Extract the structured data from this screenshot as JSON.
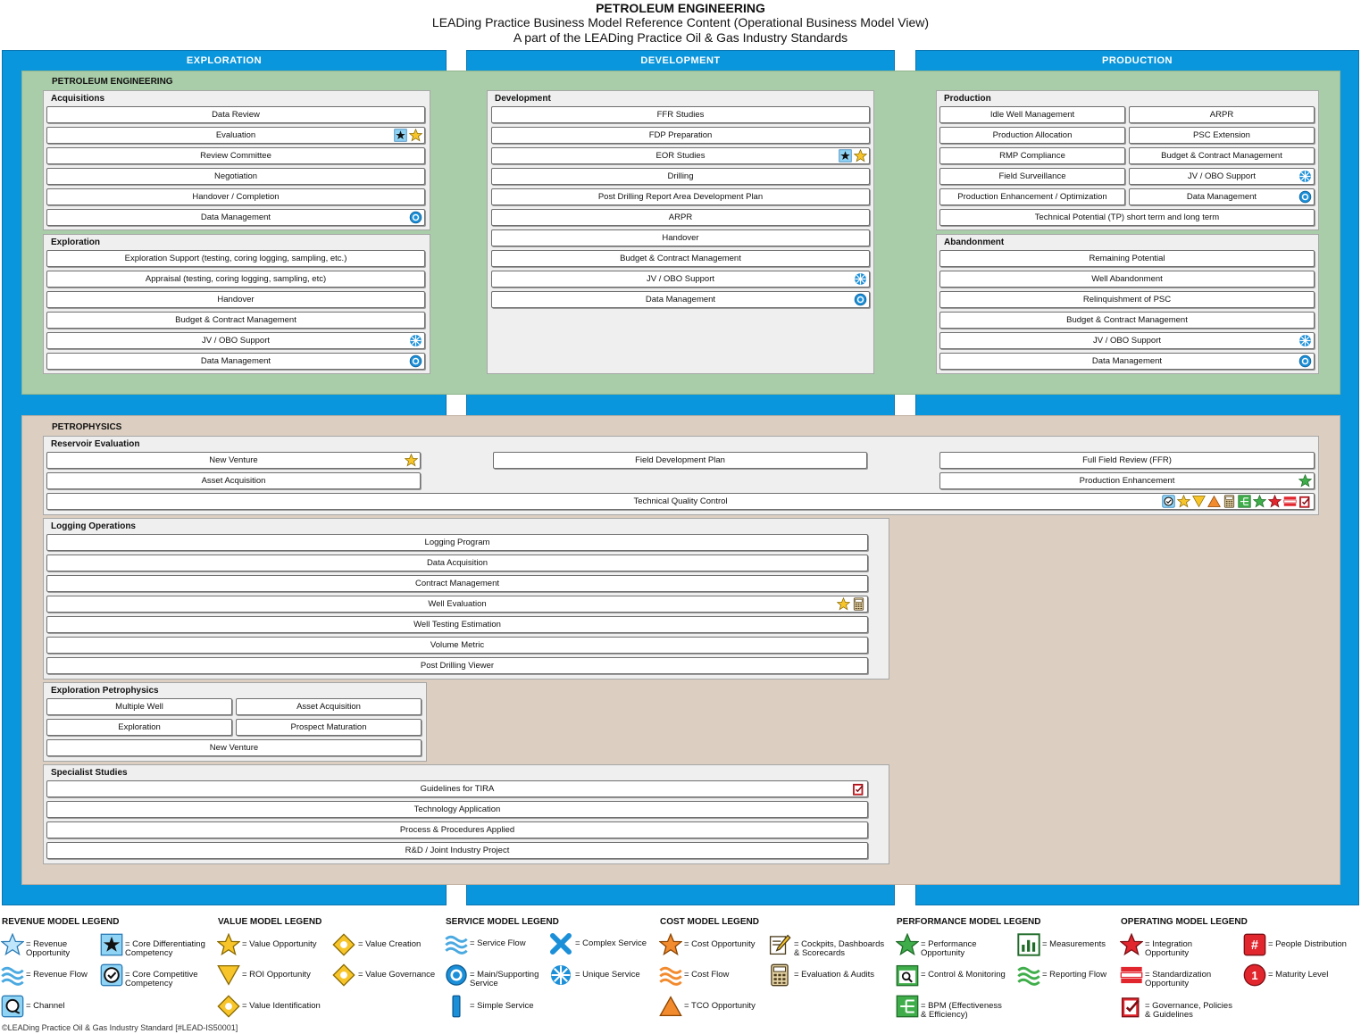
{
  "header": {
    "title": "PETROLEUM ENGINEERING",
    "subtitle": "LEADing Practice Business Model Reference Content (Operational Business Model View)",
    "subtitle2": "A part of the LEADing Practice Oil & Gas Industry Standards"
  },
  "columns": {
    "exploration": "EXPLORATION",
    "development": "DEVELOPMENT",
    "production": "PRODUCTION"
  },
  "areas": {
    "petroleum": {
      "title": "PETROLEUM ENGINEERING",
      "acquisitions": {
        "title": "Acquisitions",
        "items": [
          "Data Review",
          "Evaluation",
          "Review Committee",
          "Negotiation",
          "Handover / Completion",
          "Data Management"
        ]
      },
      "exploration": {
        "title": "Exploration",
        "items": [
          "Exploration Support (testing, coring logging, sampling, etc.)",
          "Appraisal (testing, coring logging, sampling, etc)",
          "Handover",
          "Budget & Contract Management",
          "JV / OBO Support",
          "Data Management"
        ]
      },
      "development": {
        "title": "Development",
        "items": [
          "FFR Studies",
          "FDP Preparation",
          "EOR Studies",
          "Drilling",
          "Post Drilling Report Area Development Plan",
          "ARPR",
          "Handover",
          "Budget & Contract Management",
          "JV / OBO Support",
          "Data Management"
        ]
      },
      "production": {
        "title": "Production",
        "left": [
          "Idle Well Management",
          "Production Allocation",
          "RMP Compliance",
          "Field Surveillance",
          "Production Enhancement / Optimization"
        ],
        "right": [
          "ARPR",
          "PSC Extension",
          "Budget & Contract Management",
          "JV / OBO Support",
          "Data Management"
        ],
        "full": "Technical Potential (TP) short term and long term"
      },
      "abandonment": {
        "title": "Abandonment",
        "items": [
          "Remaining Potential",
          "Well Abandonment",
          "Relinquishment of PSC",
          "Budget & Contract Management",
          "JV / OBO Support",
          "Data Management"
        ]
      }
    },
    "petrophysics": {
      "title": "PETROPHYSICS",
      "reservoir": {
        "title": "Reservoir Evaluation",
        "new_venture": "New Venture",
        "asset_acquisition": "Asset Acquisition",
        "field_dev_plan": "Field Development Plan",
        "ffr": "Full Field Review (FFR)",
        "prod_enh": "Production Enhancement",
        "tqc": "Technical Quality Control"
      },
      "logging": {
        "title": "Logging Operations",
        "items": [
          "Logging Program",
          "Data Acquisition",
          "Contract Management",
          "Well Evaluation",
          "Well Testing Estimation",
          "Volume Metric",
          "Post Drilling Viewer"
        ]
      },
      "explpetro": {
        "title": "Exploration Petrophysics",
        "items": [
          "Multiple Well",
          "Asset Acquisition",
          "Exploration",
          "Prospect Maturation",
          "New Venture"
        ]
      },
      "specialist": {
        "title": "Specialist Studies",
        "items": [
          "Guidelines for TIRA",
          "Technology Application",
          "Process & Procedures Applied",
          "R&D / Joint Industry Project"
        ]
      }
    }
  },
  "legend": {
    "revenue": {
      "title": "REVENUE MODEL LEGEND",
      "revenue_opp": "= Revenue\nOpportunity",
      "core_diff": "= Core Differentiating\nCompetency",
      "revenue_flow": "= Revenue Flow",
      "core_comp": "= Core Competitive\nCompetency",
      "channel": "= Channel"
    },
    "value": {
      "title": "VALUE MODEL LEGEND",
      "value_opp": "= Value Opportunity",
      "value_creation": "= Value Creation",
      "roi_opp": "= ROI Opportunity",
      "value_gov": "= Value Governance",
      "value_ident": "= Value Identification"
    },
    "service": {
      "title": "SERVICE MODEL LEGEND",
      "service_flow": "= Service Flow",
      "complex": "= Complex Service",
      "main_support": "= Main/Supporting\nService",
      "unique": "= Unique Service",
      "simple": "= Simple Service"
    },
    "cost": {
      "title": "COST MODEL LEGEND",
      "cost_opp": "= Cost Opportunity",
      "cockpits": "= Cockpits, Dashboards\n& Scorecards",
      "cost_flow": "= Cost Flow",
      "eval_audits": "= Evaluation & Audits",
      "tco": "= TCO Opportunity"
    },
    "performance": {
      "title": "PERFORMANCE MODEL LEGEND",
      "perf_opp": "= Performance\nOpportunity",
      "measurements": "= Measurements",
      "control": "= Control & Monitoring",
      "reporting": "= Reporting Flow",
      "bpm": "= BPM (Effectiveness\n& Efficiency)"
    },
    "operating": {
      "title": "OPERATING MODEL LEGEND",
      "integration": "= Integration\nOpportunity",
      "people": "= People Distribution",
      "standard": "= Standardization\nOpportunity",
      "maturity": "= Maturity Level",
      "governance": "= Governance, Policies\n& Guidelines"
    }
  },
  "footer": "©LEADing Practice Oil & Gas Industry Standard [#LEAD-IS50001]",
  "colors": {
    "column_blue": "#0a96dc",
    "green_area": "#a9cda8",
    "tan_area": "#dccfc2",
    "group_bg": "#efeff0"
  }
}
